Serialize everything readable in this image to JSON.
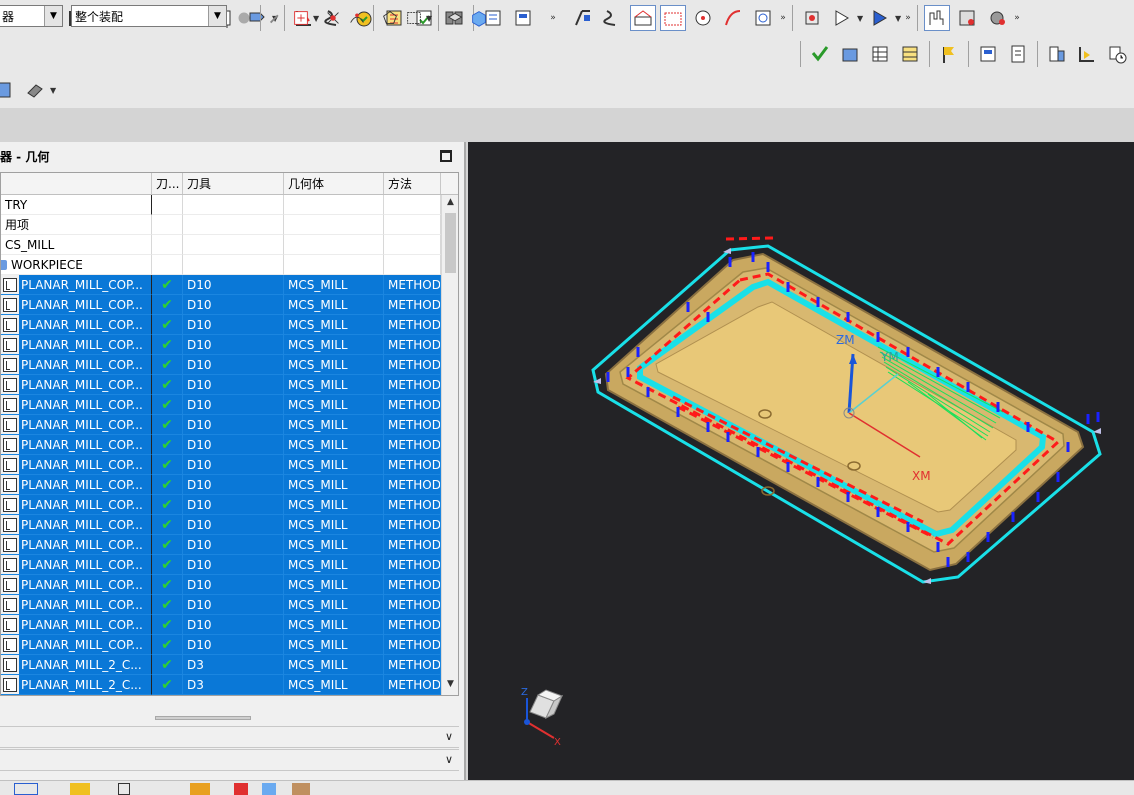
{
  "colors": {
    "selection": "#0a78d7",
    "viewport_bg": "#232326",
    "part_body": "#e8c878",
    "toolpath_cyan": "#19e0e8",
    "toolpath_red": "#ff1a1a",
    "toolpath_blue": "#1a22ff",
    "toolpath_green": "#19e05a",
    "axis_blue": "#1a55d8",
    "axis_red": "#e03030"
  },
  "toolbar": {
    "row1_icons": [
      "cut-method-icon",
      "create-operation-icon",
      "program-order-icon",
      "machine-tool-icon",
      "geometry-icon",
      "delete-icon",
      "tool-icon",
      "feed-icon",
      "generate-icon",
      "sequence-icon",
      "verify-icon",
      "postprocess-icon",
      "shop-doc-icon",
      "output-icon",
      "list-icon",
      "clsf-icon",
      "display-toolpath-icon",
      "rotate-icon",
      "ipw-icon",
      "point-icon",
      "curve-icon",
      "transform-icon",
      "create-program-icon",
      "simulate-icon",
      "animation-icon",
      "info-icon",
      "analysis-icon",
      "settings-icon"
    ],
    "row2_icons": [
      "check-icon",
      "properties-icon",
      "object-table-icon",
      "template-icon",
      "flag-icon",
      "dialog-icon",
      "document-icon",
      "assembly-icon",
      "feedback-icon",
      "clock-icon"
    ]
  },
  "filter_bar": {
    "type_filter_value": "器",
    "assembly_filter_value": "整个装配"
  },
  "navigator": {
    "title": "器 - 几何",
    "columns": {
      "name": "",
      "path": "刀...",
      "tool": "刀具",
      "geometry": "几何体",
      "method": "方法"
    },
    "header_rows": [
      {
        "name": "TRY"
      },
      {
        "name": "用项"
      },
      {
        "name": "CS_MILL"
      },
      {
        "name": "WORKPIECE"
      }
    ],
    "operations": [
      {
        "name": "PLANAR_MILL_COP...",
        "tool": "D10",
        "geometry": "MCS_MILL",
        "method": "METHOD"
      },
      {
        "name": "PLANAR_MILL_COP...",
        "tool": "D10",
        "geometry": "MCS_MILL",
        "method": "METHOD"
      },
      {
        "name": "PLANAR_MILL_COP...",
        "tool": "D10",
        "geometry": "MCS_MILL",
        "method": "METHOD"
      },
      {
        "name": "PLANAR_MILL_COP...",
        "tool": "D10",
        "geometry": "MCS_MILL",
        "method": "METHOD"
      },
      {
        "name": "PLANAR_MILL_COP...",
        "tool": "D10",
        "geometry": "MCS_MILL",
        "method": "METHOD"
      },
      {
        "name": "PLANAR_MILL_COP...",
        "tool": "D10",
        "geometry": "MCS_MILL",
        "method": "METHOD"
      },
      {
        "name": "PLANAR_MILL_COP...",
        "tool": "D10",
        "geometry": "MCS_MILL",
        "method": "METHOD"
      },
      {
        "name": "PLANAR_MILL_COP...",
        "tool": "D10",
        "geometry": "MCS_MILL",
        "method": "METHOD"
      },
      {
        "name": "PLANAR_MILL_COP...",
        "tool": "D10",
        "geometry": "MCS_MILL",
        "method": "METHOD"
      },
      {
        "name": "PLANAR_MILL_COP...",
        "tool": "D10",
        "geometry": "MCS_MILL",
        "method": "METHOD"
      },
      {
        "name": "PLANAR_MILL_COP...",
        "tool": "D10",
        "geometry": "MCS_MILL",
        "method": "METHOD"
      },
      {
        "name": "PLANAR_MILL_COP...",
        "tool": "D10",
        "geometry": "MCS_MILL",
        "method": "METHOD"
      },
      {
        "name": "PLANAR_MILL_COP...",
        "tool": "D10",
        "geometry": "MCS_MILL",
        "method": "METHOD"
      },
      {
        "name": "PLANAR_MILL_COP...",
        "tool": "D10",
        "geometry": "MCS_MILL",
        "method": "METHOD"
      },
      {
        "name": "PLANAR_MILL_COP...",
        "tool": "D10",
        "geometry": "MCS_MILL",
        "method": "METHOD"
      },
      {
        "name": "PLANAR_MILL_COP...",
        "tool": "D10",
        "geometry": "MCS_MILL",
        "method": "METHOD"
      },
      {
        "name": "PLANAR_MILL_COP...",
        "tool": "D10",
        "geometry": "MCS_MILL",
        "method": "METHOD"
      },
      {
        "name": "PLANAR_MILL_COP...",
        "tool": "D10",
        "geometry": "MCS_MILL",
        "method": "METHOD"
      },
      {
        "name": "PLANAR_MILL_COP...",
        "tool": "D10",
        "geometry": "MCS_MILL",
        "method": "METHOD"
      },
      {
        "name": "PLANAR_MILL_2_C...",
        "tool": "D3",
        "geometry": "MCS_MILL",
        "method": "METHOD"
      },
      {
        "name": "PLANAR_MILL_2_C...",
        "tool": "D3",
        "geometry": "MCS_MILL",
        "method": "METHOD"
      }
    ]
  },
  "viewport": {
    "axis_labels": {
      "zm": "ZM",
      "ym": "YM",
      "xm": "XM"
    },
    "triad_labels": {
      "z": "Z",
      "x": "X"
    }
  }
}
